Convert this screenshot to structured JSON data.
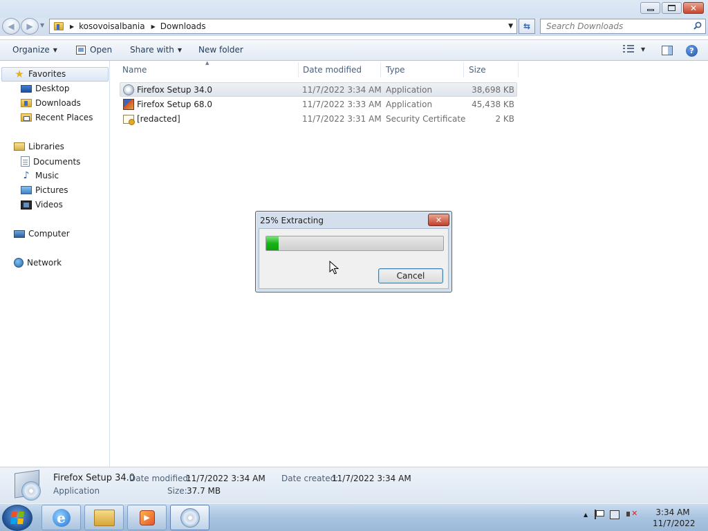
{
  "window": {
    "controls": [
      "minimize",
      "maximize",
      "close"
    ]
  },
  "address_bar": {
    "crumbs": [
      "kosovoisalbania",
      "Downloads"
    ],
    "search_placeholder": "Search Downloads"
  },
  "command_bar": {
    "organize": "Organize",
    "open": "Open",
    "share_with": "Share with",
    "new_folder": "New folder"
  },
  "nav_pane": {
    "favorites": {
      "label": "Favorites",
      "items": [
        "Desktop",
        "Downloads",
        "Recent Places"
      ]
    },
    "libraries": {
      "label": "Libraries",
      "items": [
        "Documents",
        "Music",
        "Pictures",
        "Videos"
      ]
    },
    "computer": "Computer",
    "network": "Network"
  },
  "file_list": {
    "columns": [
      "Name",
      "Date modified",
      "Type",
      "Size"
    ],
    "rows": [
      {
        "name": "Firefox Setup 34.0",
        "date": "11/7/2022 3:34 AM",
        "type": "Application",
        "size": "38,698 KB",
        "icon": "setup-cd-icon",
        "selected": true
      },
      {
        "name": "Firefox Setup 68.0",
        "date": "11/7/2022 3:33 AM",
        "type": "Application",
        "size": "45,438 KB",
        "icon": "firefox-setup-icon",
        "selected": false
      },
      {
        "name": "[redacted]",
        "date": "11/7/2022 3:31 AM",
        "type": "Security Certificate",
        "size": "2 KB",
        "icon": "certificate-icon",
        "selected": false
      }
    ]
  },
  "dialog": {
    "title": "25% Extracting",
    "progress": 0.07,
    "cancel": "Cancel",
    "close_glyph": "✕"
  },
  "details": {
    "name": "Firefox Setup 34.0",
    "kind": "Application",
    "date_modified_label": "Date modified:",
    "date_modified": "11/7/2022 3:34 AM",
    "date_created_label": "Date created:",
    "date_created": "11/7/2022 3:34 AM",
    "size_label": "Size:",
    "size": "37.7 MB"
  },
  "taskbar": {
    "time": "3:34 AM",
    "date": "11/7/2022",
    "ie_glyph": "e",
    "wmp_glyph": "▶"
  },
  "colors": {
    "progress_fill": "#19b319",
    "close_red": "#c34129",
    "accent_blue": "#2e63b8"
  }
}
